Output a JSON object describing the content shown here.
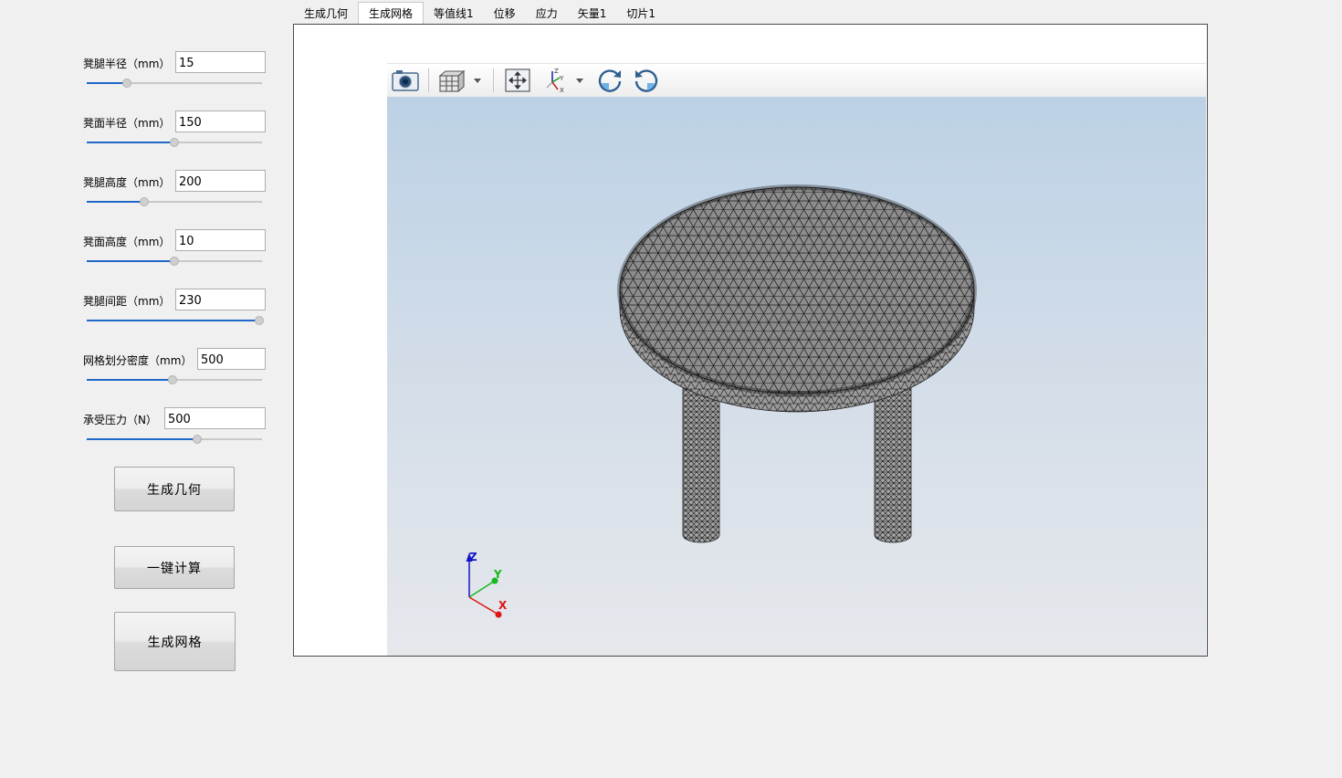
{
  "params": [
    {
      "label": "凳腿半径（mm）",
      "value": "15",
      "slider_pct": 0.23
    },
    {
      "label": "凳面半径（mm）",
      "value": "150",
      "slider_pct": 0.5
    },
    {
      "label": "凳腿高度（mm）",
      "value": "200",
      "slider_pct": 0.33
    },
    {
      "label": "凳面高度（mm）",
      "value": "10",
      "slider_pct": 0.5
    },
    {
      "label": "凳腿间距（mm）",
      "value": "230",
      "slider_pct": 1.0
    },
    {
      "label": "网格划分密度（mm）",
      "value": "500",
      "slider_pct": 0.49
    },
    {
      "label": "承受压力（N）",
      "value": "500",
      "slider_pct": 0.63
    }
  ],
  "buttons": {
    "generate_geometry": "生成几何",
    "one_click_compute": "一键计算",
    "generate_mesh": "生成网格"
  },
  "tabs": [
    "生成几何",
    "生成网格",
    "等值线1",
    "位移",
    "应力",
    "矢量1",
    "切片1"
  ],
  "active_tab_index": 1,
  "toolbar": {
    "icons": [
      "camera-icon",
      "view-cube-icon",
      "fit-view-icon",
      "axes-orientation-icon",
      "rotate-cw-icon",
      "rotate-ccw-icon"
    ]
  },
  "axes_triad": {
    "z": "Z",
    "y": "Y",
    "x": "X"
  },
  "colors": {
    "slider_fill": "#1f68c7",
    "mesh_face": "#8c8c8c",
    "axis_z": "#1414c8",
    "axis_y": "#16b81e",
    "axis_x": "#e01414"
  }
}
